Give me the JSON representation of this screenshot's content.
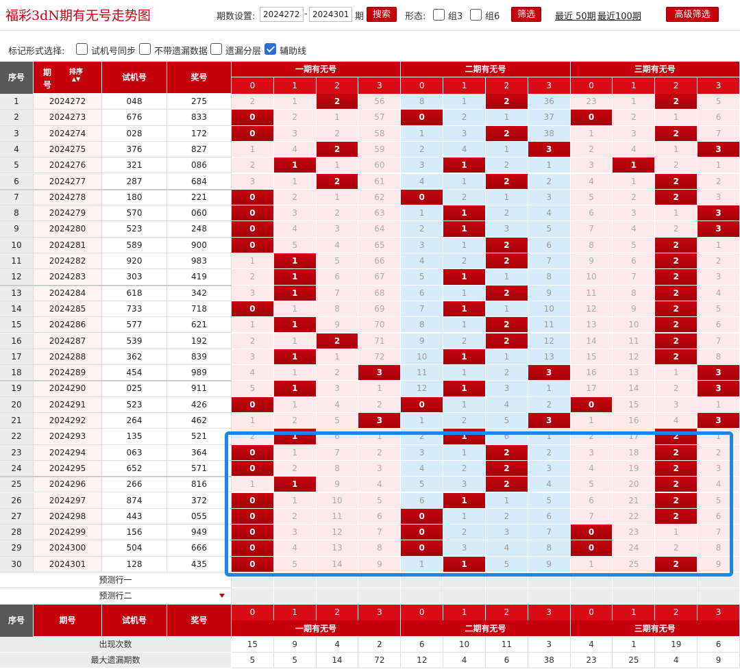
{
  "title": "福彩3dN期有无号走势图",
  "controls": {
    "period_label": "期数设置:",
    "start_period": "2024272",
    "dash": "-",
    "end_period": "2024301",
    "period_unit": "期",
    "search_label": "搜索",
    "shape_label": "形态:",
    "group3_label": "组3",
    "group6_label": "组6",
    "filter_label": "筛选",
    "last50_label": "最近 50期",
    "last100_label": "最近100期",
    "advanced_label": "高级筛选"
  },
  "marks": {
    "label": "标记形式选择:",
    "options": [
      {
        "label": "试机号同步",
        "checked": false
      },
      {
        "label": "不带遗漏数据",
        "checked": false
      },
      {
        "label": "遗漏分层",
        "checked": false
      },
      {
        "label": "辅助线",
        "checked": true
      }
    ]
  },
  "header": {
    "seq": "序号",
    "period": "期号",
    "sort": "排序",
    "test": "试机号",
    "prize": "奖号",
    "groups": [
      "一期有无号",
      "二期有无号",
      "三期有无号"
    ],
    "subcols": [
      "0",
      "1",
      "2",
      "3"
    ]
  },
  "rows": [
    {
      "seq": "1",
      "period": "2024272",
      "test": "048",
      "prize": "275",
      "cells": [
        "2",
        "1",
        "2",
        "56",
        "8",
        "1",
        "2",
        "36",
        "23",
        "1",
        "2",
        "5"
      ],
      "hits": [
        2,
        6,
        10
      ]
    },
    {
      "seq": "2",
      "period": "2024273",
      "test": "676",
      "prize": "833",
      "cells": [
        "0",
        "2",
        "1",
        "57",
        "0",
        "2",
        "1",
        "37",
        "0",
        "2",
        "1",
        "6"
      ],
      "hits": [
        0,
        4,
        8
      ]
    },
    {
      "seq": "3",
      "period": "2024274",
      "test": "028",
      "prize": "172",
      "cells": [
        "0",
        "3",
        "2",
        "58",
        "1",
        "3",
        "2",
        "38",
        "1",
        "3",
        "2",
        "7"
      ],
      "hits": [
        0,
        6,
        10
      ]
    },
    {
      "seq": "4",
      "period": "2024275",
      "test": "376",
      "prize": "827",
      "cells": [
        "1",
        "4",
        "2",
        "59",
        "2",
        "4",
        "1",
        "3",
        "2",
        "4",
        "1",
        "3"
      ],
      "hits": [
        2,
        7,
        11
      ]
    },
    {
      "seq": "5",
      "period": "2024276",
      "test": "321",
      "prize": "086",
      "cells": [
        "2",
        "1",
        "1",
        "60",
        "3",
        "1",
        "2",
        "1",
        "3",
        "1",
        "2",
        "1"
      ],
      "hits": [
        1,
        5,
        9
      ]
    },
    {
      "seq": "6",
      "period": "2024277",
      "test": "287",
      "prize": "684",
      "cells": [
        "3",
        "1",
        "2",
        "61",
        "4",
        "1",
        "2",
        "2",
        "4",
        "1",
        "2",
        "2"
      ],
      "hits": [
        2,
        6,
        10
      ]
    },
    {
      "seq": "7",
      "period": "2024278",
      "test": "180",
      "prize": "221",
      "cells": [
        "0",
        "2",
        "1",
        "62",
        "0",
        "2",
        "1",
        "3",
        "5",
        "2",
        "2",
        "3"
      ],
      "hits": [
        0,
        4,
        10
      ]
    },
    {
      "seq": "8",
      "period": "2024279",
      "test": "570",
      "prize": "060",
      "cells": [
        "0",
        "3",
        "2",
        "63",
        "1",
        "1",
        "2",
        "4",
        "6",
        "3",
        "1",
        "3"
      ],
      "hits": [
        0,
        5,
        11
      ]
    },
    {
      "seq": "9",
      "period": "2024280",
      "test": "523",
      "prize": "248",
      "cells": [
        "0",
        "4",
        "3",
        "64",
        "2",
        "1",
        "3",
        "5",
        "7",
        "4",
        "2",
        "3"
      ],
      "hits": [
        0,
        5,
        11
      ]
    },
    {
      "seq": "10",
      "period": "2024281",
      "test": "589",
      "prize": "900",
      "cells": [
        "0",
        "5",
        "4",
        "65",
        "3",
        "1",
        "2",
        "6",
        "8",
        "5",
        "2",
        "1"
      ],
      "hits": [
        0,
        6,
        10
      ]
    },
    {
      "seq": "11",
      "period": "2024282",
      "test": "920",
      "prize": "983",
      "cells": [
        "1",
        "1",
        "5",
        "66",
        "4",
        "2",
        "2",
        "7",
        "9",
        "6",
        "2",
        "2"
      ],
      "hits": [
        1,
        6,
        10
      ]
    },
    {
      "seq": "12",
      "period": "2024283",
      "test": "303",
      "prize": "419",
      "cells": [
        "2",
        "1",
        "6",
        "67",
        "5",
        "1",
        "1",
        "8",
        "10",
        "7",
        "2",
        "3"
      ],
      "hits": [
        1,
        5,
        10
      ]
    },
    {
      "seq": "13",
      "period": "2024284",
      "test": "618",
      "prize": "342",
      "cells": [
        "3",
        "1",
        "7",
        "68",
        "6",
        "1",
        "2",
        "9",
        "11",
        "8",
        "2",
        "4"
      ],
      "hits": [
        1,
        6,
        10
      ]
    },
    {
      "seq": "14",
      "period": "2024285",
      "test": "733",
      "prize": "718",
      "cells": [
        "0",
        "1",
        "8",
        "69",
        "7",
        "1",
        "1",
        "10",
        "12",
        "9",
        "2",
        "5"
      ],
      "hits": [
        0,
        5,
        10
      ]
    },
    {
      "seq": "15",
      "period": "2024286",
      "test": "577",
      "prize": "621",
      "cells": [
        "1",
        "1",
        "9",
        "70",
        "8",
        "1",
        "2",
        "11",
        "13",
        "10",
        "2",
        "6"
      ],
      "hits": [
        1,
        6,
        10
      ]
    },
    {
      "seq": "16",
      "period": "2024287",
      "test": "539",
      "prize": "192",
      "cells": [
        "2",
        "1",
        "2",
        "71",
        "9",
        "2",
        "2",
        "12",
        "14",
        "11",
        "2",
        "7"
      ],
      "hits": [
        2,
        6,
        10
      ]
    },
    {
      "seq": "17",
      "period": "2024288",
      "test": "362",
      "prize": "839",
      "cells": [
        "3",
        "1",
        "1",
        "72",
        "10",
        "1",
        "1",
        "13",
        "15",
        "12",
        "2",
        "8"
      ],
      "hits": [
        1,
        5,
        10
      ]
    },
    {
      "seq": "18",
      "period": "2024289",
      "test": "454",
      "prize": "989",
      "cells": [
        "4",
        "1",
        "2",
        "3",
        "11",
        "1",
        "2",
        "3",
        "16",
        "13",
        "1",
        "3"
      ],
      "hits": [
        3,
        7,
        11
      ]
    },
    {
      "seq": "19",
      "period": "2024290",
      "test": "025",
      "prize": "911",
      "cells": [
        "5",
        "1",
        "3",
        "1",
        "12",
        "1",
        "3",
        "1",
        "17",
        "14",
        "2",
        "3"
      ],
      "hits": [
        1,
        5,
        11
      ]
    },
    {
      "seq": "20",
      "period": "2024291",
      "test": "523",
      "prize": "426",
      "cells": [
        "0",
        "1",
        "4",
        "2",
        "0",
        "1",
        "4",
        "2",
        "0",
        "15",
        "3",
        "1"
      ],
      "hits": [
        0,
        4,
        8
      ]
    },
    {
      "seq": "21",
      "period": "2024292",
      "test": "264",
      "prize": "462",
      "cells": [
        "1",
        "2",
        "5",
        "3",
        "1",
        "2",
        "5",
        "3",
        "1",
        "16",
        "4",
        "3"
      ],
      "hits": [
        3,
        7,
        11
      ]
    },
    {
      "seq": "22",
      "period": "2024293",
      "test": "135",
      "prize": "521",
      "cells": [
        "2",
        "1",
        "6",
        "1",
        "2",
        "1",
        "6",
        "1",
        "2",
        "17",
        "2",
        "1"
      ],
      "hits": [
        1,
        5,
        10
      ]
    },
    {
      "seq": "23",
      "period": "2024294",
      "test": "063",
      "prize": "364",
      "cells": [
        "0",
        "1",
        "7",
        "2",
        "3",
        "1",
        "2",
        "2",
        "3",
        "18",
        "2",
        "2"
      ],
      "hits": [
        0,
        6,
        10
      ]
    },
    {
      "seq": "24",
      "period": "2024295",
      "test": "652",
      "prize": "571",
      "cells": [
        "0",
        "2",
        "8",
        "3",
        "4",
        "2",
        "2",
        "3",
        "4",
        "19",
        "2",
        "3"
      ],
      "hits": [
        0,
        6,
        10
      ]
    },
    {
      "seq": "25",
      "period": "2024296",
      "test": "266",
      "prize": "816",
      "cells": [
        "1",
        "1",
        "9",
        "4",
        "5",
        "3",
        "2",
        "4",
        "5",
        "20",
        "2",
        "4"
      ],
      "hits": [
        1,
        6,
        10
      ]
    },
    {
      "seq": "26",
      "period": "2024297",
      "test": "874",
      "prize": "372",
      "cells": [
        "0",
        "1",
        "10",
        "5",
        "6",
        "1",
        "1",
        "5",
        "6",
        "21",
        "2",
        "5"
      ],
      "hits": [
        0,
        5,
        10
      ]
    },
    {
      "seq": "27",
      "period": "2024298",
      "test": "443",
      "prize": "055",
      "cells": [
        "0",
        "2",
        "11",
        "6",
        "0",
        "1",
        "2",
        "6",
        "7",
        "22",
        "2",
        "6"
      ],
      "hits": [
        0,
        4,
        10
      ]
    },
    {
      "seq": "28",
      "period": "2024299",
      "test": "156",
      "prize": "949",
      "cells": [
        "0",
        "3",
        "12",
        "7",
        "0",
        "2",
        "3",
        "7",
        "0",
        "23",
        "1",
        "7"
      ],
      "hits": [
        0,
        4,
        8
      ]
    },
    {
      "seq": "29",
      "period": "2024300",
      "test": "504",
      "prize": "666",
      "cells": [
        "0",
        "4",
        "13",
        "8",
        "0",
        "3",
        "4",
        "8",
        "0",
        "24",
        "2",
        "8"
      ],
      "hits": [
        0,
        4,
        8
      ]
    },
    {
      "seq": "30",
      "period": "2024301",
      "test": "128",
      "prize": "435",
      "cells": [
        "0",
        "5",
        "14",
        "9",
        "1",
        "1",
        "5",
        "9",
        "1",
        "25",
        "2",
        "9"
      ],
      "hits": [
        0,
        5,
        10
      ]
    }
  ],
  "prediction": [
    "预测行一",
    "预测行二"
  ],
  "stats": [
    {
      "label": "出现次数",
      "values": [
        "15",
        "9",
        "4",
        "2",
        "6",
        "10",
        "11",
        "3",
        "4",
        "1",
        "19",
        "6"
      ]
    },
    {
      "label": "最大遗漏期数",
      "values": [
        "5",
        "5",
        "14",
        "72",
        "12",
        "4",
        "6",
        "38",
        "23",
        "25",
        "4",
        "9"
      ]
    }
  ]
}
